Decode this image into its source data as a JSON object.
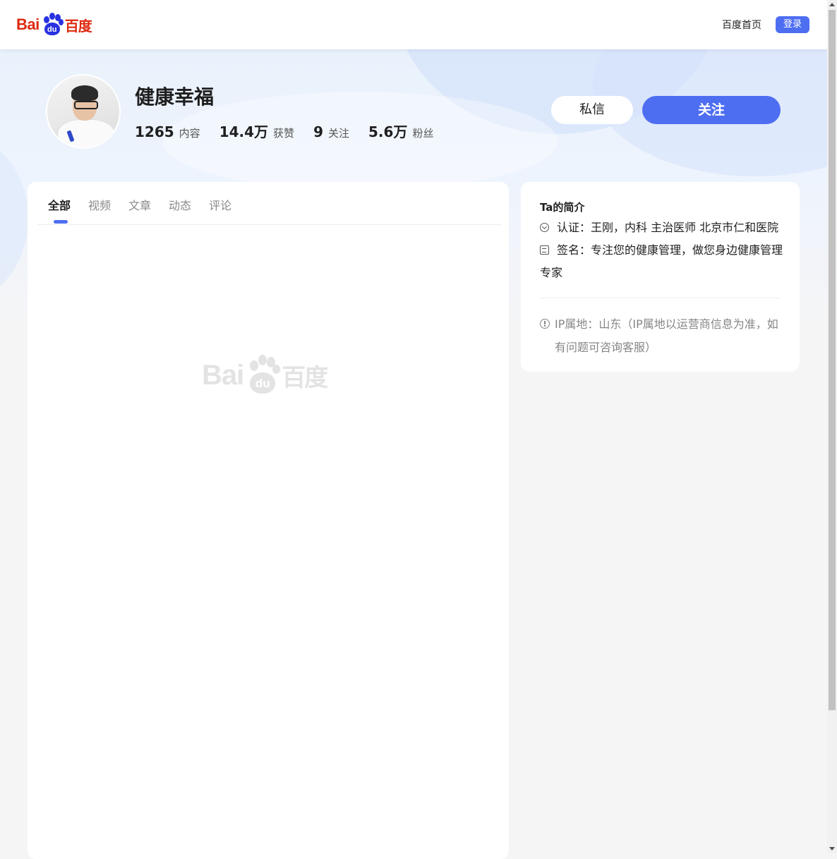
{
  "header": {
    "logo_text_left": "Bai",
    "logo_text_paw": "du",
    "logo_text_right": "百度",
    "home_link": "百度首页",
    "login_label": "登录"
  },
  "profile": {
    "name": "健康幸福",
    "stats": [
      {
        "value": "1265",
        "label": "内容"
      },
      {
        "value": "14.4万",
        "label": "获赞"
      },
      {
        "value": "9",
        "label": "关注"
      },
      {
        "value": "5.6万",
        "label": "粉丝"
      }
    ],
    "message_label": "私信",
    "follow_label": "关注"
  },
  "tabs": [
    {
      "label": "全部",
      "active": true
    },
    {
      "label": "视频",
      "active": false
    },
    {
      "label": "文章",
      "active": false
    },
    {
      "label": "动态",
      "active": false
    },
    {
      "label": "评论",
      "active": false
    }
  ],
  "watermark": {
    "left": "Bai",
    "paw": "du",
    "right": "百度"
  },
  "intro": {
    "title": "Ta的简介",
    "certification": "认证：王刚，内科 主治医师 北京市仁和医院",
    "signature": "签名：专注您的健康管理，做您身边健康管理专家",
    "ip_location": "IP属地：山东（IP属地以运营商信息为准，如有问题可咨询客服）"
  },
  "colors": {
    "accent": "#4e6ef2",
    "brand_red": "#de2910",
    "brand_blue": "#2932e1"
  }
}
